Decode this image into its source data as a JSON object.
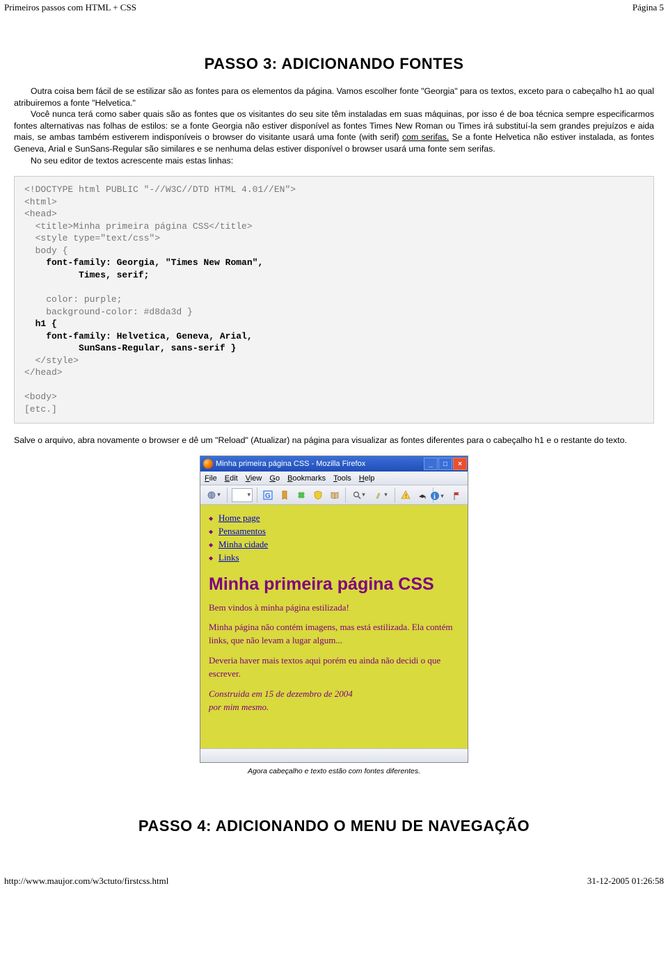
{
  "header": {
    "title": "Primeiros passos com HTML + CSS",
    "page_label": "Página 5"
  },
  "section3": {
    "heading": "PASSO 3: ADICIONANDO FONTES",
    "p1_a": "Outra coisa bem fácil de se estilizar são as fontes para os elementos da página. Vamos escolher fonte \"Georgia\" para os textos, exceto para o cabeçalho h1 ao qual atribuiremos a fonte \"Helvetica.\"",
    "p1_b_prefix": "Você nunca terá como saber quais são as fontes que os visitantes do seu site têm instaladas em suas máquinas, por isso é de boa técnica sempre especificarmos fontes alternativas nas folhas de estilos: se a fonte Georgia não estiver disponível as fontes Times New Roman ou Times irá substituí-la sem grandes prejuízos e aida mais, se ambas também estiverem indisponíveis o browser do visitante usará uma fonte (with serif) ",
    "p1_b_link": "com serifas.",
    "p1_b_suffix": " Se a fonte Helvetica não estiver instalada, as fontes Geneva, Arial e SunSans-Regular são similares e se nenhuma delas estiver disponível o browser usará uma fonte sem serifas.",
    "p1_c": "No seu editor de textos acrescente mais estas linhas:",
    "code": {
      "l1": "<!DOCTYPE html PUBLIC \"-//W3C//DTD HTML 4.01//EN\">",
      "l2": "<html>",
      "l3": "<head>",
      "l4": "  <title>Minha primeira página CSS</title>",
      "l5": "  <style type=\"text/css\">",
      "l6": "  body {",
      "l7": "    font-family: Georgia, \"Times New Roman\",",
      "l8": "          Times, serif;",
      "l9": "    color: purple;",
      "l10": "    background-color: #d8da3d }",
      "l11": "  h1 {",
      "l12": "    font-family: Helvetica, Geneva, Arial,",
      "l13": "          SunSans-Regular, sans-serif }",
      "l14": "  </style>",
      "l15": "</head>",
      "l16": "<body>",
      "l17": "[etc.]"
    },
    "after_code": "Salve o arquivo, abra novamente o browser e dê um \"Reload\" (Atualizar) na página para visualizar as fontes diferentes para o cabeçalho h1 e o restante do texto."
  },
  "browser": {
    "title": "Minha primeira página CSS - Mozilla Firefox",
    "menus": {
      "file": "File",
      "edit": "Edit",
      "view": "View",
      "go": "Go",
      "bookmarks": "Bookmarks",
      "tools": "Tools",
      "help": "Help"
    },
    "nav_items": [
      "Home page",
      "Pensamentos",
      "Minha cidade",
      "Links"
    ],
    "h1": "Minha primeira página CSS",
    "p1": "Bem vindos à minha página estilizada!",
    "p2": "Minha página não contém imagens, mas está estilizada. Ela contém links, que não levam a lugar algum...",
    "p3": "Deveria haver mais textos aqui porém eu ainda não decidi o que escrever.",
    "signoff_1": "Construida em 15 de dezembro de 2004",
    "signoff_2": "por mim mesmo."
  },
  "caption": "Agora cabeçalho e texto estão com fontes diferentes.",
  "section4": {
    "heading": "PASSO 4: ADICIONANDO O MENU DE NAVEGAÇÃO"
  },
  "footer": {
    "url": "http://www.maujor.com/w3ctuto/firstcss.html",
    "timestamp": "31-12-2005 01:26:58"
  }
}
